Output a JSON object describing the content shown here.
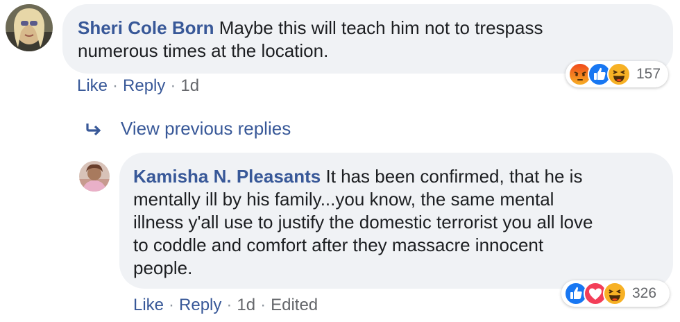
{
  "comments": [
    {
      "author": "Sheri Cole Born",
      "text_line1": "Maybe this will teach him not to trespass",
      "text_line2": "numerous times at the location.",
      "like": "Like",
      "reply": "Reply",
      "time": "1d",
      "reactions": [
        "angry-icon",
        "like-icon",
        "haha-icon"
      ],
      "reaction_count": "157"
    },
    {
      "author": "Kamisha N. Pleasants",
      "text_line1": "It has been confirmed, that he is",
      "text_line2": "mentally ill by his family...you know, the same mental",
      "text_line3": "illness y'all use to justify the domestic terrorist you all love",
      "text_line4": "to coddle and comfort after they massacre innocent",
      "text_line5": "people.",
      "like": "Like",
      "reply": "Reply",
      "time": "1d",
      "edited": "Edited",
      "reactions": [
        "like-icon",
        "love-icon",
        "haha-icon"
      ],
      "reaction_count": "326"
    }
  ],
  "view_previous_replies": "View previous replies",
  "colors": {
    "link": "#385898",
    "bubble": "#f0f2f5",
    "like_blue": "#1877f2",
    "love_red": "#f33e58",
    "haha_yellow": "#f7b125",
    "angry_orange": "#e9710f"
  }
}
